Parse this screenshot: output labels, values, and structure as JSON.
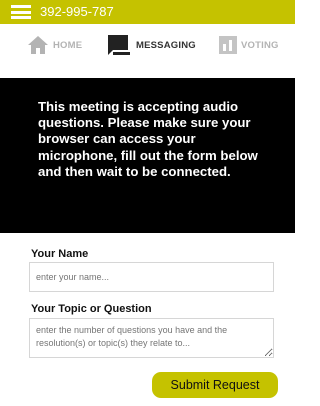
{
  "header": {
    "meeting_id": "392-995-787",
    "background_color": "#c5c200"
  },
  "nav": {
    "items": [
      {
        "label": "HOME",
        "icon": "home-icon",
        "active": false
      },
      {
        "label": "MESSAGING",
        "icon": "chat-bubble-icon",
        "active": true
      },
      {
        "label": "VOTING",
        "icon": "bar-chart-icon",
        "active": false
      }
    ]
  },
  "notice": {
    "text": "This meeting is accepting audio questions. Please make sure your browser can access your microphone, fill out the form below and then wait to be connected."
  },
  "form": {
    "name_label": "Your Name",
    "name_placeholder": "enter your name...",
    "topic_label": "Your Topic or Question",
    "topic_placeholder": "enter the number of questions you have and the resolution(s) or topic(s) they relate to...",
    "submit_label": "Submit Request"
  }
}
